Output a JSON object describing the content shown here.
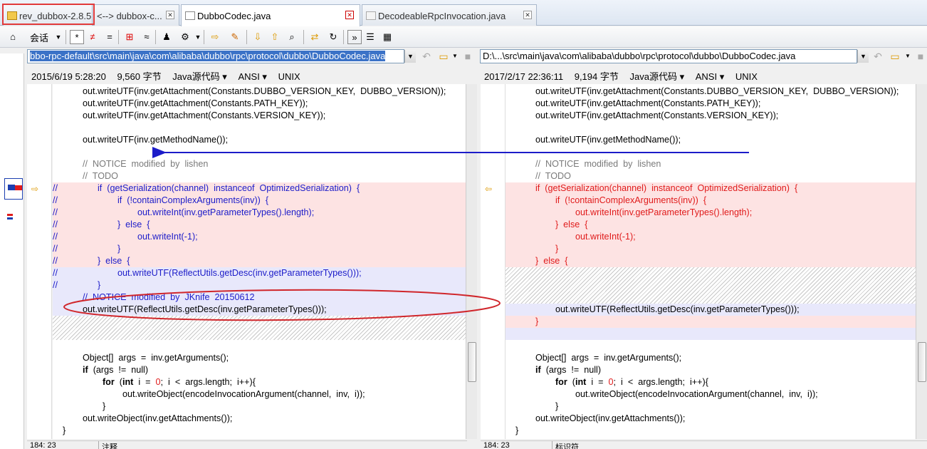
{
  "tabs": [
    {
      "label": "rev_dubbox-2.8.5",
      "close": ""
    },
    {
      "label": "<--> dubbox-c...",
      "close": "✕"
    },
    {
      "label": "DubboCodec.java",
      "close": "✕"
    },
    {
      "label": "DecodeableRpcInvocation.java",
      "close": "✕"
    }
  ],
  "toolbar": {
    "session_label": "会话"
  },
  "left": {
    "path": "bbo-rpc-default\\src\\main\\java\\com\\alibaba\\dubbo\\rpc\\protocol\\dubbo\\DubboCodec.java",
    "info": {
      "date": "2015/6/19 5:28:20",
      "size": "9,560 字节",
      "format": "Java源代码 ▾",
      "encoding": "ANSI ▾",
      "lineend": "UNIX"
    },
    "lines": [
      {
        "t": "            out.writeUTF(inv.getAttachment(Constants.DUBBO_VERSION_KEY,  DUBBO_VERSION));",
        "c": "",
        "k": ""
      },
      {
        "t": "            out.writeUTF(inv.getAttachment(Constants.PATH_KEY));",
        "c": "",
        "k": ""
      },
      {
        "t": "            out.writeUTF(inv.getAttachment(Constants.VERSION_KEY));",
        "c": "",
        "k": ""
      },
      {
        "t": "",
        "c": "",
        "k": ""
      },
      {
        "t": "            out.writeUTF(inv.getMethodName());",
        "c": "",
        "k": ""
      },
      {
        "t": "",
        "c": "",
        "k": ""
      },
      {
        "t": "            //  NOTICE  modified  by  lishen",
        "c": "",
        "k": "cmt"
      },
      {
        "t": "            //  TODO",
        "c": "",
        "k": "cmt"
      },
      {
        "t": "//                if  (getSerialization(channel)  instanceof  OptimizedSerialization)  {",
        "c": "red",
        "k": "bl"
      },
      {
        "t": "//                        if  (!containComplexArguments(inv))  {",
        "c": "red",
        "k": "bl"
      },
      {
        "t": "//                                out.writeInt(inv.getParameterTypes().length);",
        "c": "red",
        "k": "bl"
      },
      {
        "t": "//                        }  else  {",
        "c": "red",
        "k": "bl"
      },
      {
        "t": "//                                out.writeInt(-1);",
        "c": "red",
        "k": "bl"
      },
      {
        "t": "//                        }",
        "c": "red",
        "k": "bl"
      },
      {
        "t": "//                }  else  {",
        "c": "red",
        "k": "bl"
      },
      {
        "t": "//                        out.writeUTF(ReflectUtils.getDesc(inv.getParameterTypes()));",
        "c": "blu",
        "k": "bl"
      },
      {
        "t": "//                }",
        "c": "blu",
        "k": "bl"
      },
      {
        "t": "            //  NOTICE  modified  by  JKnife  20150612",
        "c": "blu",
        "k": "bl"
      },
      {
        "t": "            out.writeUTF(ReflectUtils.getDesc(inv.getParameterTypes()));",
        "c": "blu",
        "k": ""
      },
      {
        "t": "",
        "c": "hatch",
        "k": ""
      },
      {
        "t": "",
        "c": "hatch",
        "k": ""
      },
      {
        "t": "",
        "c": "",
        "k": ""
      },
      {
        "t": "            Object[]  args  =  inv.getArguments();",
        "c": "",
        "k": ""
      },
      {
        "t": "            if  (args  !=  null)",
        "c": "",
        "k": ""
      },
      {
        "t": "                    for  (int  i  =  0;  i  <  args.length;  i++){",
        "c": "",
        "k": ""
      },
      {
        "t": "                            out.writeObject(encodeInvocationArgument(channel,  inv,  i));",
        "c": "",
        "k": ""
      },
      {
        "t": "                    }",
        "c": "",
        "k": ""
      },
      {
        "t": "            out.writeObject(inv.getAttachments());",
        "c": "",
        "k": ""
      },
      {
        "t": "    }",
        "c": "",
        "k": ""
      }
    ],
    "status": [
      "184: 23",
      "注释"
    ]
  },
  "right": {
    "path": "D:\\...\\src\\main\\java\\com\\alibaba\\dubbo\\rpc\\protocol\\dubbo\\DubboCodec.java",
    "info": {
      "date": "2017/2/17 22:36:11",
      "size": "9,194 字节",
      "format": "Java源代码 ▾",
      "encoding": "ANSI ▾",
      "lineend": "UNIX"
    },
    "lines": [
      {
        "t": "            out.writeUTF(inv.getAttachment(Constants.DUBBO_VERSION_KEY,  DUBBO_VERSION));",
        "c": "",
        "k": ""
      },
      {
        "t": "            out.writeUTF(inv.getAttachment(Constants.PATH_KEY));",
        "c": "",
        "k": ""
      },
      {
        "t": "            out.writeUTF(inv.getAttachment(Constants.VERSION_KEY));",
        "c": "",
        "k": ""
      },
      {
        "t": "",
        "c": "",
        "k": ""
      },
      {
        "t": "            out.writeUTF(inv.getMethodName());",
        "c": "",
        "k": ""
      },
      {
        "t": "",
        "c": "",
        "k": ""
      },
      {
        "t": "            //  NOTICE  modified  by  lishen",
        "c": "",
        "k": "cmt"
      },
      {
        "t": "            //  TODO",
        "c": "",
        "k": "cmt"
      },
      {
        "t": "            if  (getSerialization(channel)  instanceof  OptimizedSerialization)  {",
        "c": "red",
        "k": "rd"
      },
      {
        "t": "                    if  (!containComplexArguments(inv))  {",
        "c": "red",
        "k": "rd"
      },
      {
        "t": "                            out.writeInt(inv.getParameterTypes().length);",
        "c": "red",
        "k": "rd"
      },
      {
        "t": "                    }  else  {",
        "c": "red",
        "k": "rd"
      },
      {
        "t": "                            out.writeInt(-1);",
        "c": "red",
        "k": "rd"
      },
      {
        "t": "                    }",
        "c": "red",
        "k": "rd"
      },
      {
        "t": "            }  else  {",
        "c": "red",
        "k": "rd"
      },
      {
        "t": "",
        "c": "hatch",
        "k": ""
      },
      {
        "t": "",
        "c": "hatch",
        "k": ""
      },
      {
        "t": "",
        "c": "hatch",
        "k": ""
      },
      {
        "t": "                    out.writeUTF(ReflectUtils.getDesc(inv.getParameterTypes()));",
        "c": "blu",
        "k": ""
      },
      {
        "t": "            }",
        "c": "red",
        "k": "rd"
      },
      {
        "t": "",
        "c": "blu",
        "k": ""
      },
      {
        "t": "",
        "c": "",
        "k": ""
      },
      {
        "t": "            Object[]  args  =  inv.getArguments();",
        "c": "",
        "k": ""
      },
      {
        "t": "            if  (args  !=  null)",
        "c": "",
        "k": ""
      },
      {
        "t": "                    for  (int  i  =  0;  i  <  args.length;  i++){",
        "c": "",
        "k": ""
      },
      {
        "t": "                            out.writeObject(encodeInvocationArgument(channel,  inv,  i));",
        "c": "",
        "k": ""
      },
      {
        "t": "                    }",
        "c": "",
        "k": ""
      },
      {
        "t": "            out.writeObject(inv.getAttachments());",
        "c": "",
        "k": ""
      },
      {
        "t": "    }",
        "c": "",
        "k": ""
      }
    ],
    "status": [
      "184: 23",
      "标识符"
    ]
  },
  "colors": {
    "annotation_red": "#e23a3a",
    "arrow_blue": "#1c1cc9"
  }
}
